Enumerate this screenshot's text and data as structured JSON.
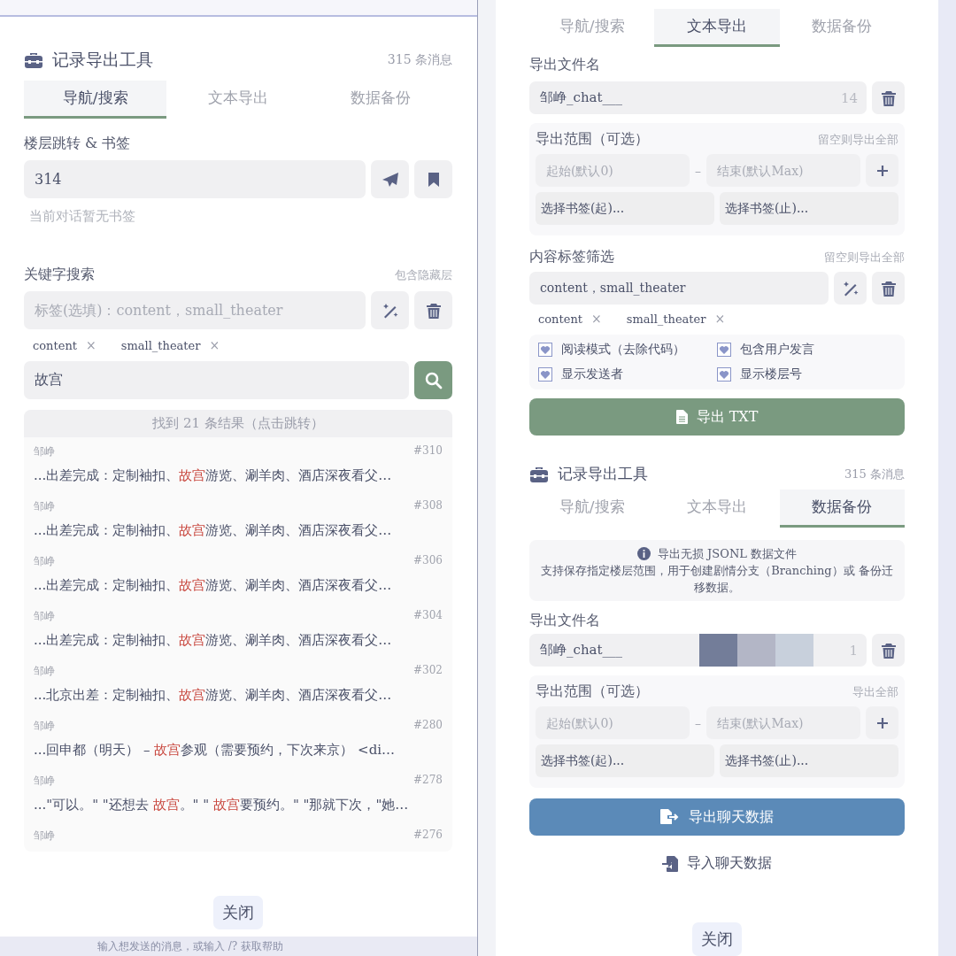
{
  "left_panel": {
    "header": {
      "title": "记录导出工具",
      "count": "315 条消息"
    },
    "tabs": [
      {
        "label": "导航/搜索",
        "selected": true
      },
      {
        "label": "文本导出",
        "selected": false
      },
      {
        "label": "数据备份",
        "selected": false
      }
    ],
    "jump": {
      "label": "楼层跳转 & 书签",
      "value": "314",
      "note": "当前对话暂无书签"
    },
    "keyword_search": {
      "label": "关键字搜索",
      "hint": "包含隐藏层",
      "tag_placeholder": "标签(选填)：content，small_theater",
      "tags": [
        {
          "label": "content",
          "remove": "×"
        },
        {
          "label": "small_theater",
          "remove": "×"
        }
      ],
      "query": "故宫"
    },
    "results": {
      "summary": "找到 21 条结果（点击跳转）",
      "items": [
        {
          "sender": "邹峥",
          "floor": "#310",
          "parts": [
            {
              "text": "...出差完成：定制袖扣、",
              "match": false
            },
            {
              "text": "故宫",
              "match": true
            },
            {
              "text": "游览、涮羊肉、酒店深夜看父…",
              "match": false
            }
          ]
        },
        {
          "sender": "邹峥",
          "floor": "#308",
          "parts": [
            {
              "text": "...出差完成：定制袖扣、",
              "match": false
            },
            {
              "text": "故宫",
              "match": true
            },
            {
              "text": "游览、涮羊肉、酒店深夜看父…",
              "match": false
            }
          ]
        },
        {
          "sender": "邹峥",
          "floor": "#306",
          "parts": [
            {
              "text": "...出差完成：定制袖扣、",
              "match": false
            },
            {
              "text": "故宫",
              "match": true
            },
            {
              "text": "游览、涮羊肉、酒店深夜看父…",
              "match": false
            }
          ]
        },
        {
          "sender": "邹峥",
          "floor": "#304",
          "parts": [
            {
              "text": "...出差完成：定制袖扣、",
              "match": false
            },
            {
              "text": "故宫",
              "match": true
            },
            {
              "text": "游览、涮羊肉、酒店深夜看父…",
              "match": false
            }
          ]
        },
        {
          "sender": "邹峥",
          "floor": "#302",
          "parts": [
            {
              "text": "...北京出差：定制袖扣、",
              "match": false
            },
            {
              "text": "故宫",
              "match": true
            },
            {
              "text": "游览、涮羊肉、酒店深夜看父…",
              "match": false
            }
          ]
        },
        {
          "sender": "邹峥",
          "floor": "#280",
          "parts": [
            {
              "text": "...回申都（明天） – ",
              "match": false
            },
            {
              "text": "故宫",
              "match": true
            },
            {
              "text": "参观（需要预约，下次来京） <di…",
              "match": false
            }
          ]
        },
        {
          "sender": "邹峥",
          "floor": "#278",
          "parts": [
            {
              "text": "...\"可以。\" \"还想去 ",
              "match": false
            },
            {
              "text": "故宫",
              "match": true
            },
            {
              "text": "。\" \" ",
              "match": false
            },
            {
              "text": "故宫",
              "match": true
            },
            {
              "text": "要预约。\" \"那就下次，\"她…",
              "match": false
            }
          ]
        },
        {
          "sender": "邹峥",
          "floor": "#276"
        }
      ]
    },
    "close": "关闭",
    "composer": {
      "placeholder": "输入想发送的消息，或输入 /? 获取帮助"
    }
  },
  "right_panel": {
    "text_export": {
      "tabs": [
        {
          "label": "导航/搜索",
          "selected": false
        },
        {
          "label": "文本导出",
          "selected": true
        },
        {
          "label": "数据备份",
          "selected": false
        }
      ],
      "filename": {
        "label": "导出文件名",
        "value": "邹峥_chat___",
        "suffix": "14"
      },
      "range": {
        "label": "导出范围（可选）",
        "hint": "留空则导出全部",
        "start_placeholder": "起始(默认0)",
        "separator": "–",
        "end_placeholder": "结束(默认Max)",
        "bookmark_start": "选择书签(起)...",
        "bookmark_end": "选择书签(止)..."
      },
      "tag_filter": {
        "label": "内容标签筛选",
        "hint": "留空则导出全部",
        "value": "content，small_theater",
        "tags": [
          {
            "label": "content",
            "remove": "×"
          },
          {
            "label": "small_theater",
            "remove": "×"
          }
        ]
      },
      "options": [
        {
          "label": "阅读模式（去除代码）",
          "checked": true
        },
        {
          "label": "包含用户发言",
          "checked": true
        },
        {
          "label": "显示发送者",
          "checked": true
        },
        {
          "label": "显示楼层号",
          "checked": true
        }
      ],
      "export_button": "导出 TXT"
    },
    "data_backup": {
      "header": {
        "title": "记录导出工具",
        "count": "315 条消息"
      },
      "tabs": [
        {
          "label": "导航/搜索",
          "selected": false
        },
        {
          "label": "文本导出",
          "selected": false
        },
        {
          "label": "数据备份",
          "selected": true
        }
      ],
      "info": {
        "title": "导出无损 JSONL 数据文件",
        "body": "支持保存指定楼层范围，用于创建剧情分支（Branching）或 备份迁移数据。"
      },
      "filename": {
        "label": "导出文件名",
        "value": "邹峥_chat___",
        "suffix": "1"
      },
      "range": {
        "label": "导出范围（可选）",
        "hint": "导出全部",
        "start_placeholder": "起始(默认0)",
        "separator": "–",
        "end_placeholder": "结束(默认Max)",
        "bookmark_start": "选择书签(起)...",
        "bookmark_end": "选择书签(止)..."
      },
      "export_button": "导出聊天数据",
      "import_button": "导入聊天数据"
    },
    "close": "关闭"
  }
}
